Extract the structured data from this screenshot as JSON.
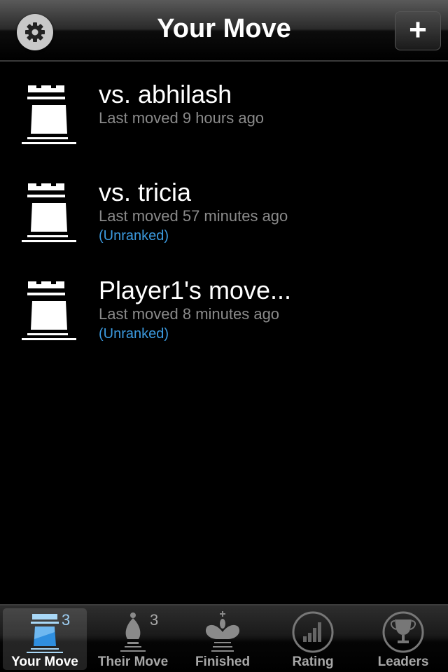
{
  "header": {
    "title": "Your Move",
    "settings_icon": "gear-icon",
    "add_icon": "plus-icon"
  },
  "games": [
    {
      "title": "vs. abhilash",
      "subtitle": "Last moved 9 hours ago",
      "tag": "",
      "icon": "rook-icon"
    },
    {
      "title": "vs. tricia",
      "subtitle": "Last moved 57 minutes ago",
      "tag": "(Unranked)",
      "icon": "rook-icon"
    },
    {
      "title": "Player1's move...",
      "subtitle": "Last moved 8 minutes ago",
      "tag": "(Unranked)",
      "icon": "rook-icon"
    }
  ],
  "tabs": [
    {
      "label": "Your Move",
      "badge": "3",
      "icon": "rook-icon",
      "active": true
    },
    {
      "label": "Their Move",
      "badge": "3",
      "icon": "bishop-icon"
    },
    {
      "label": "Finished",
      "icon": "king-icon"
    },
    {
      "label": "Rating",
      "icon": "bar-chart-icon"
    },
    {
      "label": "Leaders",
      "icon": "trophy-icon"
    }
  ],
  "colors": {
    "accent": "#3c9be0",
    "subtitle": "#8a8a8a"
  }
}
